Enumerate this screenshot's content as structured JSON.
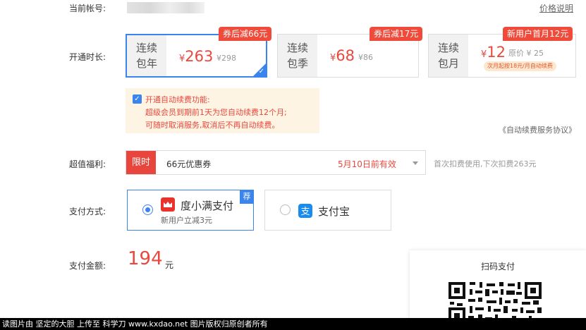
{
  "account": {
    "label": "当前帐号:"
  },
  "price_link": "价格说明",
  "duration": {
    "label": "开通时长:",
    "plans": [
      {
        "name_line1": "连续",
        "name_line2": "包年",
        "currency": "¥",
        "price": "263",
        "original": "¥298",
        "badge": "券后减66元",
        "selected": true
      },
      {
        "name_line1": "连续",
        "name_line2": "包季",
        "currency": "¥",
        "price": "68",
        "original": "¥86",
        "badge": "券后减17元",
        "selected": false
      },
      {
        "name_line1": "连续",
        "name_line2": "包月",
        "currency": "¥",
        "price": "12",
        "original": "原价 ¥ 25",
        "badge": "新用户首月12元",
        "note": "次月起按18元/月自动续费",
        "selected": false
      }
    ]
  },
  "autorenew": {
    "checked": true,
    "title": "开通自动续费功能:",
    "line1": "超级会员到期前1天为您自动续费12个月;",
    "line2": "可随时取消服务,取消后不再自动续费。"
  },
  "agreement": "《自动续费服务协议》",
  "benefits": {
    "label": "超值福利:",
    "tag": "限时",
    "coupon": "66元优惠券",
    "valid": "5月10日前有效",
    "hint": "首次扣费使用,下次扣费263元"
  },
  "payment": {
    "label": "支付方式:",
    "methods": [
      {
        "name": "度小满支付",
        "sub": "新用户立减3元",
        "tag": "荐",
        "selected": true,
        "icon": "duxiaoman-icon"
      },
      {
        "name": "支付宝",
        "selected": false,
        "icon": "alipay-icon"
      }
    ]
  },
  "amount": {
    "label": "支付金额:",
    "value": "194",
    "unit": "元"
  },
  "qr": {
    "title": "扫码支付"
  },
  "footer": "读图片由 坚定的大胆 上传至 科学刀 www.kxdao.net 图片版权归原创者所有",
  "colors": {
    "accent": "#3a84f0",
    "price": "#e8483d",
    "badge": "#ef4a3a",
    "notice_bg": "#fdf4e3"
  }
}
